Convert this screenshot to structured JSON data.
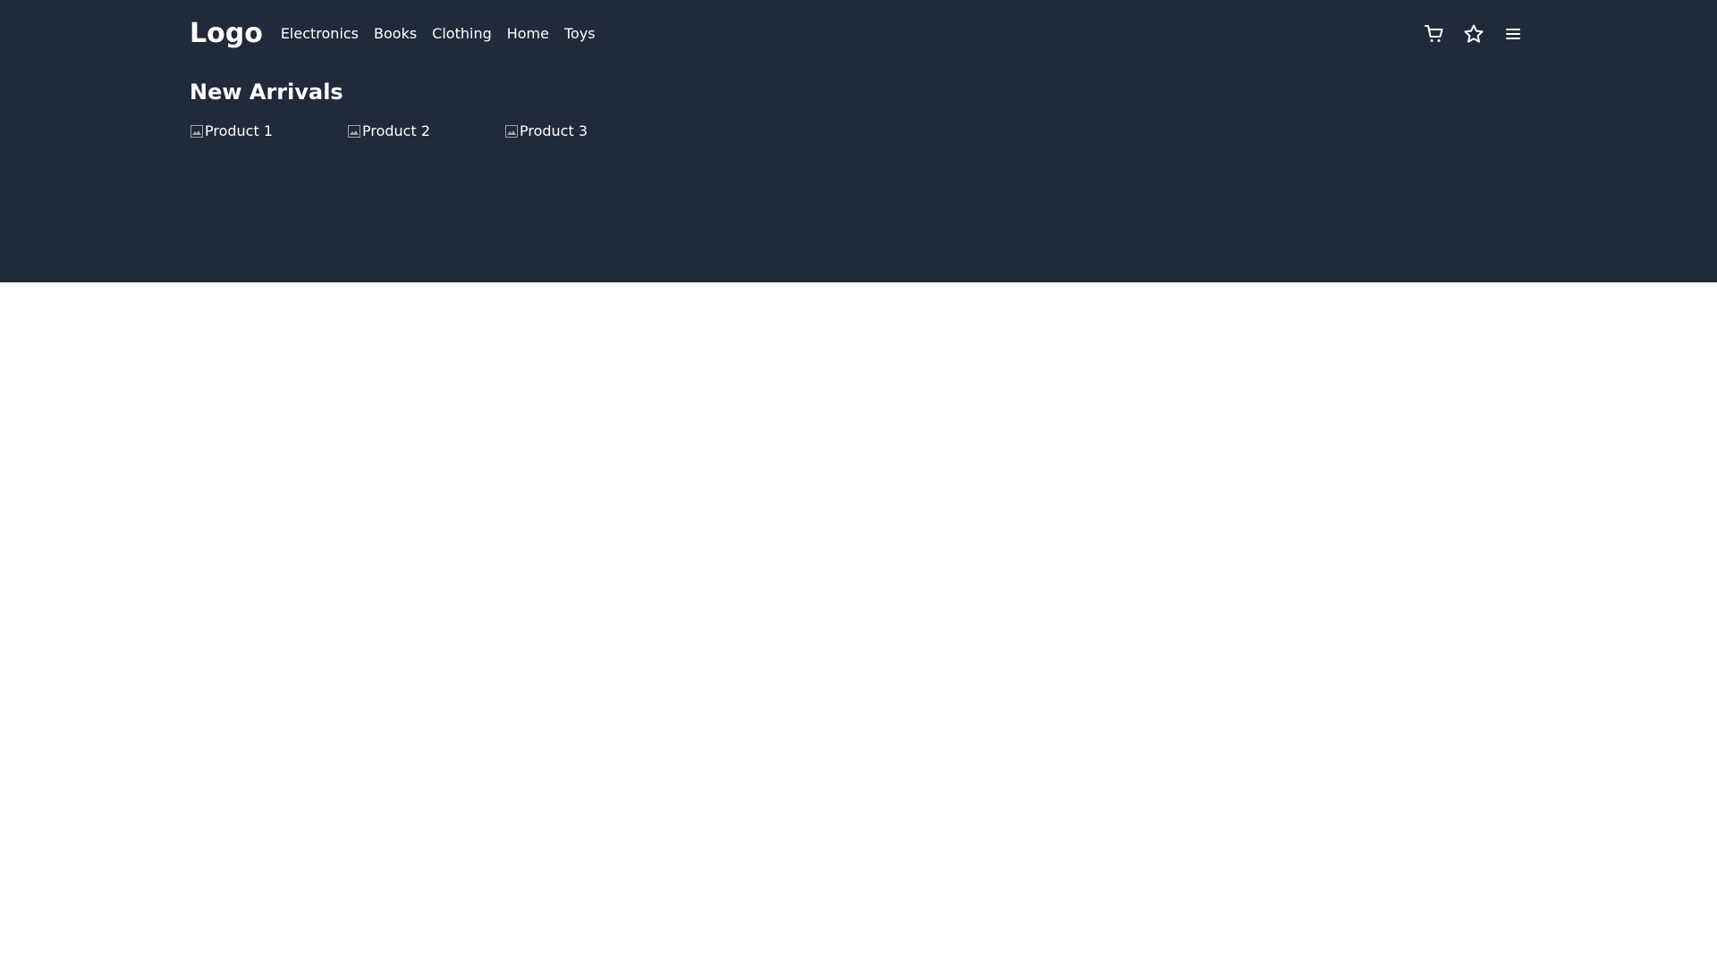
{
  "brand": {
    "logo_text": "Logo"
  },
  "nav": {
    "items": [
      {
        "label": "Electronics"
      },
      {
        "label": "Books"
      },
      {
        "label": "Clothing"
      },
      {
        "label": "Home"
      },
      {
        "label": "Toys"
      }
    ],
    "icons": [
      {
        "name": "cart-icon"
      },
      {
        "name": "star-icon"
      },
      {
        "name": "menu-icon"
      }
    ]
  },
  "section": {
    "title": "New Arrivals",
    "products": [
      {
        "alt": "Product 1"
      },
      {
        "alt": "Product 2"
      },
      {
        "alt": "Product 3"
      }
    ]
  },
  "colors": {
    "hero_background": "#212a3a",
    "page_background": "#ffffff",
    "text": "#ffffff"
  }
}
